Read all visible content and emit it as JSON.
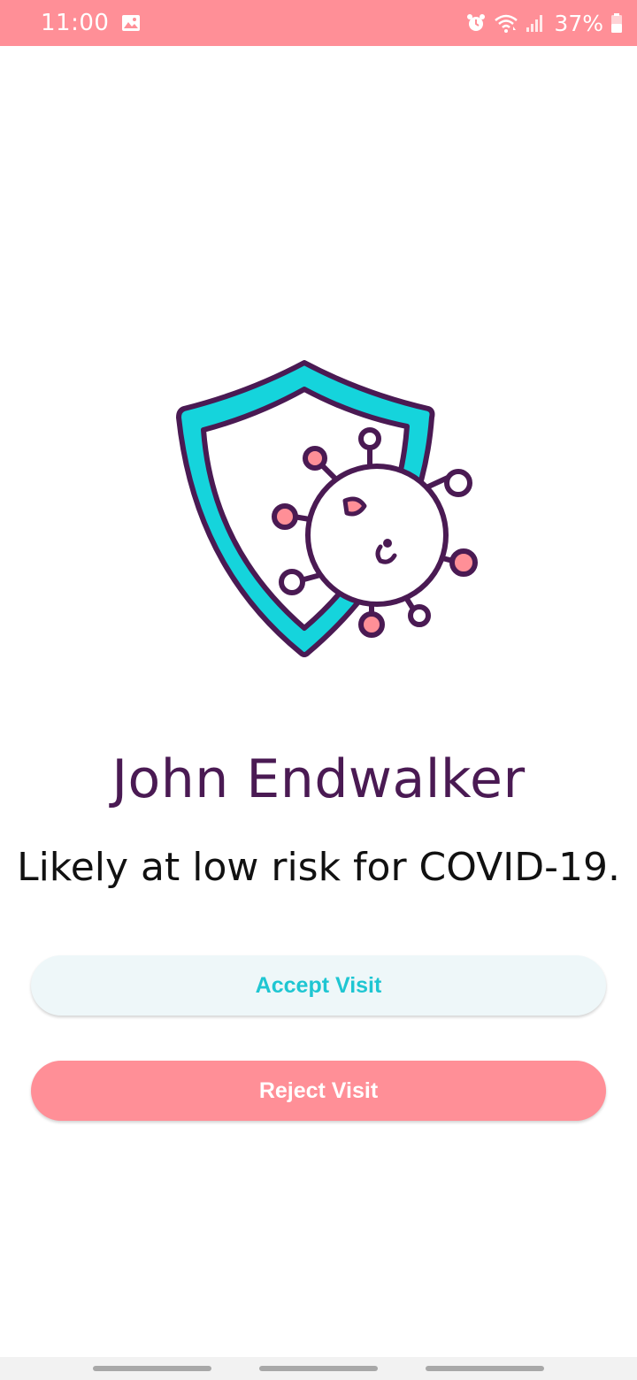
{
  "status_bar": {
    "time": "11:00",
    "battery": "37%",
    "icons": [
      "gallery-icon",
      "alarm-icon",
      "wifi-icon",
      "signal-icon",
      "battery-icon"
    ],
    "background": "#ff8f97"
  },
  "illustration": {
    "icon": "shield-virus-icon",
    "colors": {
      "shield": "#15d4dc",
      "outline": "#4a1a53",
      "virus_accent": "#ff8f97"
    }
  },
  "patient": {
    "name": "John Endwalker",
    "risk_text": "Likely at low risk for COVID-19."
  },
  "actions": {
    "accept_label": "Accept Visit",
    "reject_label": "Reject Visit"
  },
  "colors": {
    "name_text": "#4a1a53",
    "accept_text": "#1fc6d2",
    "accept_bg": "#eef7f9",
    "reject_bg": "#ff8f97"
  }
}
